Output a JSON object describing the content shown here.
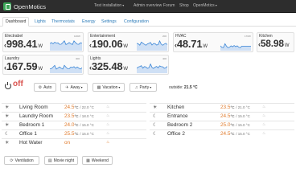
{
  "app": {
    "brand": "OpenMotics"
  },
  "topnav": {
    "installation": "Test installation",
    "admin": "Admin overview",
    "forum": "Forum",
    "shop": "Shop",
    "user": "OpenMotics"
  },
  "tabs": [
    "Dashboard",
    "Lights",
    "Thermostats",
    "Energy",
    "Settings",
    "Configuration"
  ],
  "active_tab": "Dashboard",
  "power_cards": [
    {
      "label": "Electrabel",
      "value": "998.41",
      "unit": "W",
      "max": "100W",
      "level": 0.55
    },
    {
      "label": "Entertainment",
      "value": "190.06",
      "unit": "W",
      "max": "200",
      "level": 0.5
    },
    {
      "label": "HVAC",
      "value": "48.71",
      "unit": "W",
      "max": "170W",
      "level": 0.3
    },
    {
      "label": "Kitchen",
      "value": "58.98",
      "unit": "W"
    },
    {
      "label": "Laundry",
      "value": "167.59",
      "unit": "W",
      "max": "300",
      "level": 0.4
    },
    {
      "label": "Lights",
      "value": "325.48",
      "unit": "W",
      "max": "400",
      "level": 0.45
    }
  ],
  "status": {
    "state": "off",
    "buttons": {
      "auto": "Auto",
      "away": "Away",
      "vacation": "Vacation",
      "party": "Party"
    },
    "outside_label": "outside:",
    "outside_value": "21.5 °C"
  },
  "thermostats_left": [
    {
      "icon": "sun-icon",
      "name": "Living Room",
      "temp": "24.5",
      "unit": "°C",
      "setpoint": "/ 22.0 °C",
      "heating": false
    },
    {
      "icon": "sun-icon",
      "name": "Laundry Room",
      "temp": "23.5",
      "unit": "°C",
      "setpoint": "/ 18.0 °C",
      "heating": false
    },
    {
      "icon": "sun-icon",
      "name": "Bedroom 1",
      "temp": "24.0",
      "unit": "°C",
      "setpoint": "/ 15.0 °C",
      "heating": false
    },
    {
      "icon": "moon-icon",
      "name": "Office 1",
      "temp": "25.5",
      "unit": "°C",
      "setpoint": "/ 15.0 °C",
      "heating": false
    },
    {
      "icon": "sun-icon",
      "name": "Hot Water",
      "temp": "on",
      "unit": "",
      "setpoint": "",
      "heating": true
    }
  ],
  "thermostats_right": [
    {
      "icon": "sun-icon",
      "name": "Kitchen",
      "temp": "23.5",
      "unit": "°C",
      "setpoint": "/ 21.0 °C",
      "heating": false
    },
    {
      "icon": "moon-icon",
      "name": "Entrance",
      "temp": "24.5",
      "unit": "°C",
      "setpoint": "/ 15.0 °C",
      "heating": false
    },
    {
      "icon": "moon-icon",
      "name": "Bedroom 2",
      "temp": "25.0",
      "unit": "°C",
      "setpoint": "/ 15.0 °C",
      "heating": false
    },
    {
      "icon": "moon-icon",
      "name": "Office 2",
      "temp": "24.5",
      "unit": "°C",
      "setpoint": "/ 15.0 °C",
      "heating": false
    }
  ],
  "scenes": [
    "Ventilation",
    "Movie night",
    "Weekend"
  ],
  "colors": {
    "brand": "#3aa356",
    "off": "#d9534f",
    "temp": "#e07b2d",
    "link": "#2a7ab8",
    "spark": "#3b86d6"
  }
}
